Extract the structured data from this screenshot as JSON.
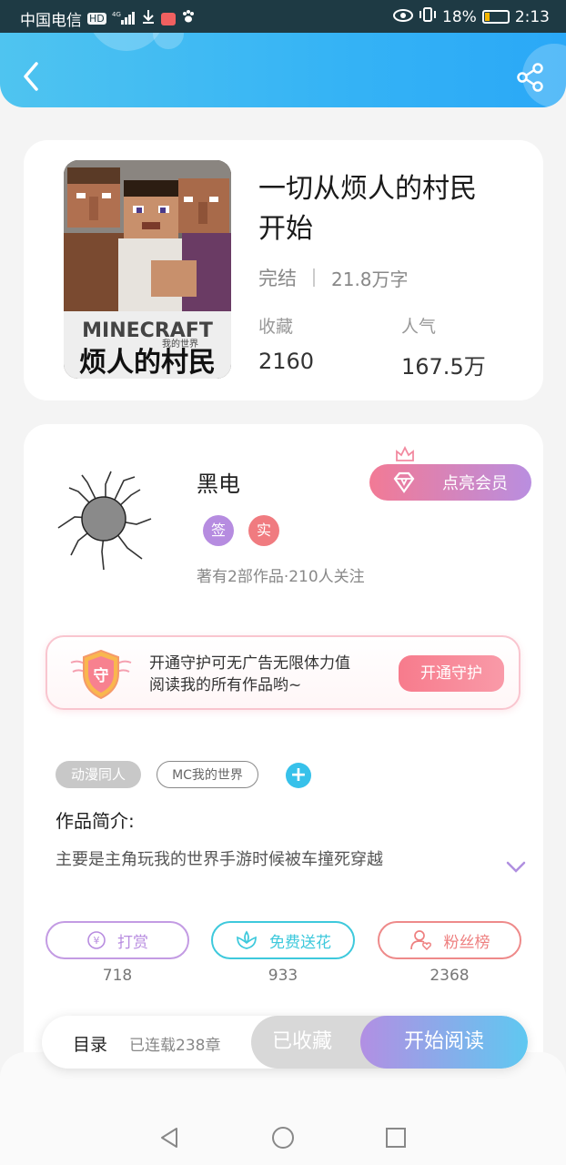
{
  "status_bar": {
    "carrier": "中国电信",
    "hd": "HD",
    "network": "4G",
    "battery": "18%",
    "time": "2:13"
  },
  "book": {
    "title_line1": "一切从烦人的村民",
    "title_line2": "开始",
    "status": "完结",
    "word_count": "21.8万字",
    "favorites_label": "收藏",
    "favorites_value": "2160",
    "popularity_label": "人气",
    "popularity_value": "167.5万",
    "cover_logo": "MINECRAFT",
    "cover_logo_sub": "我的世界",
    "cover_caption": "烦人的村民"
  },
  "author": {
    "name": "黑电",
    "badge_sign": "签",
    "badge_real": "实",
    "info": "著有2部作品·210人关注",
    "vip_button": "点亮会员"
  },
  "guard": {
    "shield_char": "守",
    "line1": "开通守护可无广告无限体力值",
    "line2": "阅读我的所有作品哟~",
    "button": "开通守护"
  },
  "tags": [
    "动漫同人",
    "MC我的世界"
  ],
  "tag_add": "+",
  "intro": {
    "title": "作品简介:",
    "text": "主要是主角玩我的世界手游时候被车撞死穿越"
  },
  "actions": [
    {
      "label": "打赏",
      "icon": "yen-coin-icon",
      "count": "718"
    },
    {
      "label": "免费送花",
      "icon": "flower-icon",
      "count": "933"
    },
    {
      "label": "粉丝榜",
      "icon": "fan-user-icon",
      "count": "2368"
    }
  ],
  "yen_symbol": "¥",
  "bottom_bar": {
    "toc": "目录",
    "chapters": "已连载238章",
    "favorited": "已收藏",
    "start_reading": "开始阅读"
  },
  "colors": {
    "header_start": "#4fc4f0",
    "header_end": "#2aa8f7",
    "vip_start": "#f27a95",
    "vip_end": "#b98ee0",
    "reward_purple": "#b98ee0",
    "flower_cyan": "#3ec9dc",
    "fans_red": "#ee8080"
  }
}
